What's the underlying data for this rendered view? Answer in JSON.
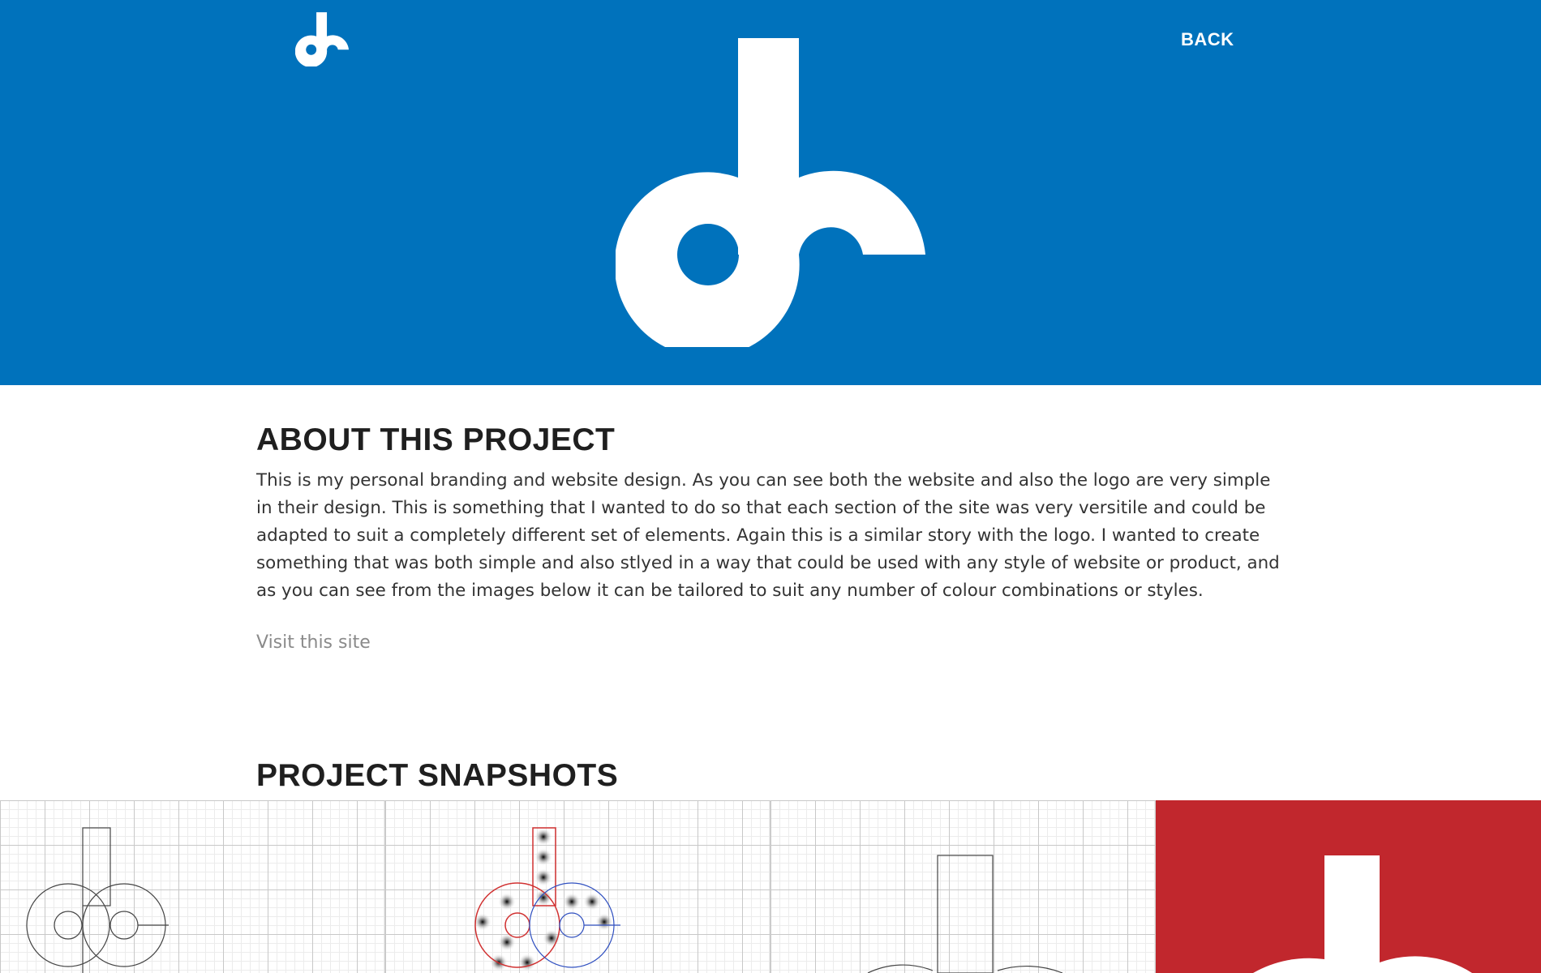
{
  "header": {
    "logo_icon": "dh-monogram-icon",
    "back_label": "BACK"
  },
  "about": {
    "title": "ABOUT THIS PROJECT",
    "body": "This is my personal branding and website design. As you can see both the website and also the logo are very simple in their design. This is something that I wanted to do so that each section of the site was very versitile and could be adapted to suit a completely different set of elements. Again this is a similar story with the logo. I wanted to create something that was both simple and also stlyed in a way that could be used with any style of website or product, and as you can see from the images below it can be tailored to suit any number of colour combinations or styles.",
    "link_label": "Visit this site"
  },
  "snapshots": {
    "title": "PROJECT SNAPSHOTS"
  },
  "colors": {
    "brand_blue": "#0072bc",
    "accent_red": "#c1272d",
    "text_dark": "#1f1f1f",
    "link_gray": "#8a8a8a"
  }
}
